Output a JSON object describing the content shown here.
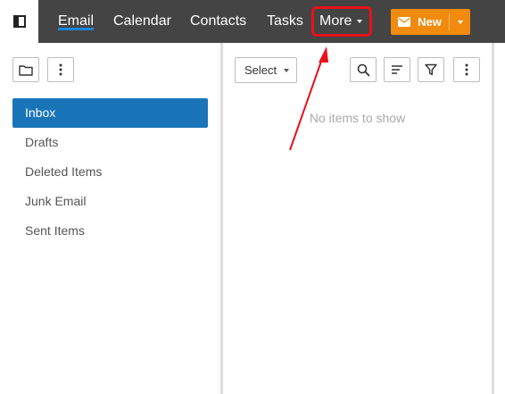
{
  "nav": {
    "items": [
      {
        "label": "Email",
        "active": true
      },
      {
        "label": "Calendar"
      },
      {
        "label": "Contacts"
      },
      {
        "label": "Tasks"
      },
      {
        "label": "More"
      }
    ],
    "new_button_label": "New"
  },
  "folders": [
    {
      "label": "Inbox",
      "selected": true
    },
    {
      "label": "Drafts"
    },
    {
      "label": "Deleted Items"
    },
    {
      "label": "Junk Email"
    },
    {
      "label": "Sent Items"
    }
  ],
  "toolbar": {
    "select_label": "Select"
  },
  "message_list": {
    "empty_text": "No items to show"
  },
  "icons": {
    "app_toggle": "sidebar-toggle-icon",
    "new_folder": "folder-icon",
    "folder_more": "more-vertical-icon",
    "search": "search-icon",
    "sort": "sort-icon",
    "filter": "filter-icon",
    "list_more": "more-vertical-icon",
    "new_mail": "envelope-icon"
  },
  "colors": {
    "topbar": "#444444",
    "accent": "#1a74b8",
    "new_button": "#f08b0f",
    "annotation": "#e8101a"
  }
}
